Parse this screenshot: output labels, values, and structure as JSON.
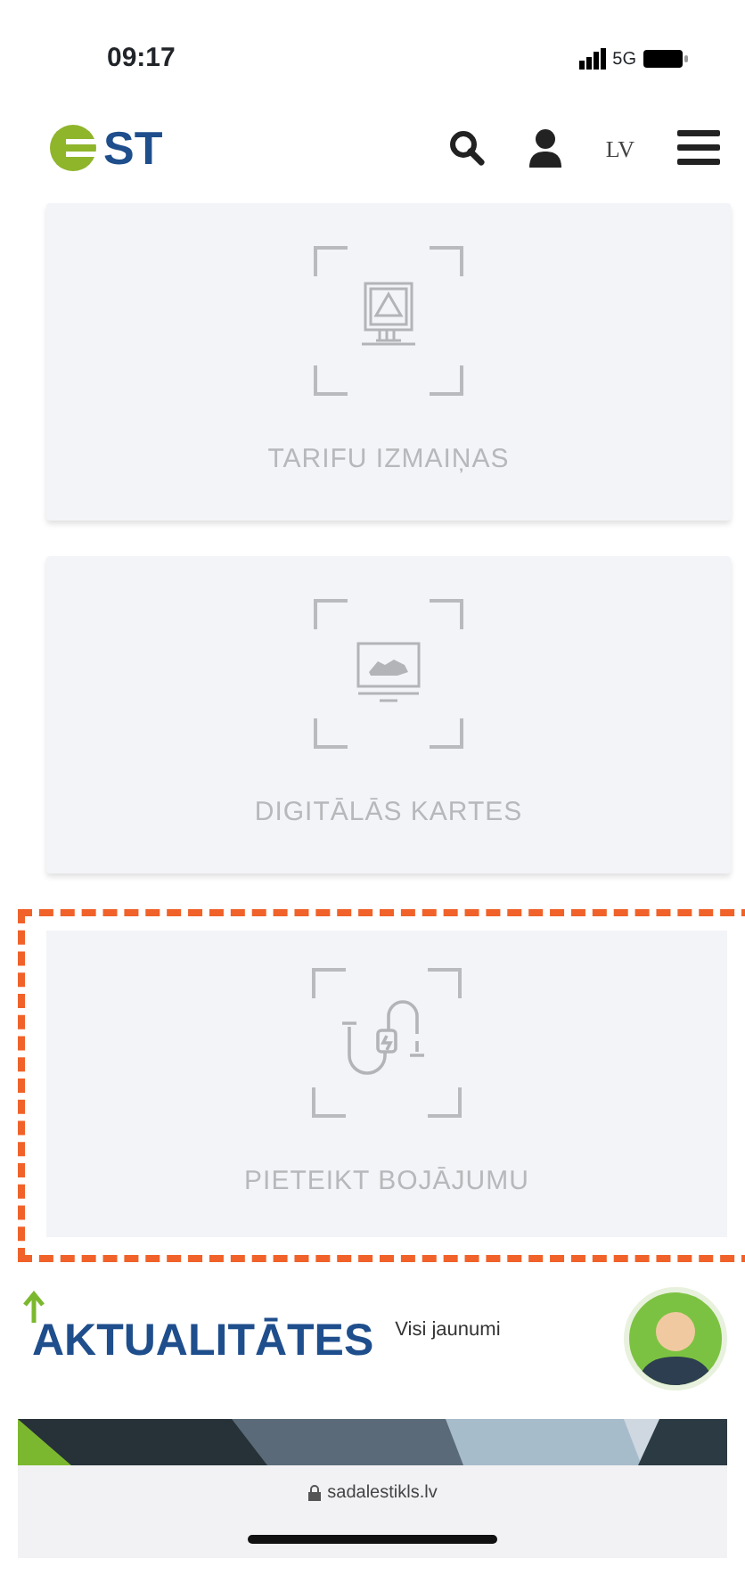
{
  "status_bar": {
    "time": "09:17",
    "network": "5G"
  },
  "header": {
    "logo_text": "ST",
    "language": "LV"
  },
  "tiles": [
    {
      "kind": "tariff",
      "label": "TARIFU IZMAIŅAS",
      "highlighted": false
    },
    {
      "kind": "map",
      "label": "DIGITĀLĀS KARTES",
      "highlighted": false
    },
    {
      "kind": "fault",
      "label": "PIETEIKT BOJĀJUMU",
      "highlighted": true
    }
  ],
  "news": {
    "title": "AKTUALITĀTES",
    "link": "Visi jaunumi"
  },
  "browser": {
    "url": "sadalestikls.lv"
  }
}
